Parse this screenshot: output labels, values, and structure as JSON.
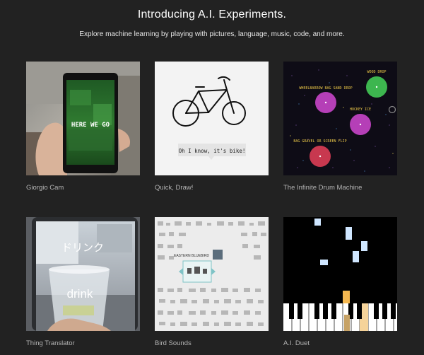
{
  "header": {
    "title": "Introducing A.I. Experiments.",
    "subtitle": "Explore machine learning by playing with pictures, language, music, code, and more."
  },
  "experiments": [
    {
      "label": "Giorgio Cam",
      "overlay_text": "HERE WE GO"
    },
    {
      "label": "Quick, Draw!",
      "speech_text": "Oh I know, it's bike!"
    },
    {
      "label": "The Infinite Drum Machine",
      "sound_labels": [
        "WOOD DROP",
        "WHEELBARROW BAG SAND DROP",
        "HOCKEY ICE",
        "BAG GRAVEL OR SCREEN FLIP"
      ]
    },
    {
      "label": "Thing Translator",
      "japanese_text": "ドリンク",
      "cup_text": "drink"
    },
    {
      "label": "Bird Sounds",
      "bird_name": "EASTERN BLUEBIRD"
    },
    {
      "label": "A.I. Duet"
    }
  ],
  "colors": {
    "background": "#222222",
    "label": "#b4b4b4",
    "drum_magenta": "#b53fb7",
    "drum_red": "#c8384f",
    "drum_green": "#3db64f",
    "drum_label_yellow": "#e8c547",
    "duet_note_blue": "#cfe6ff",
    "duet_note_orange": "#f5b850"
  }
}
